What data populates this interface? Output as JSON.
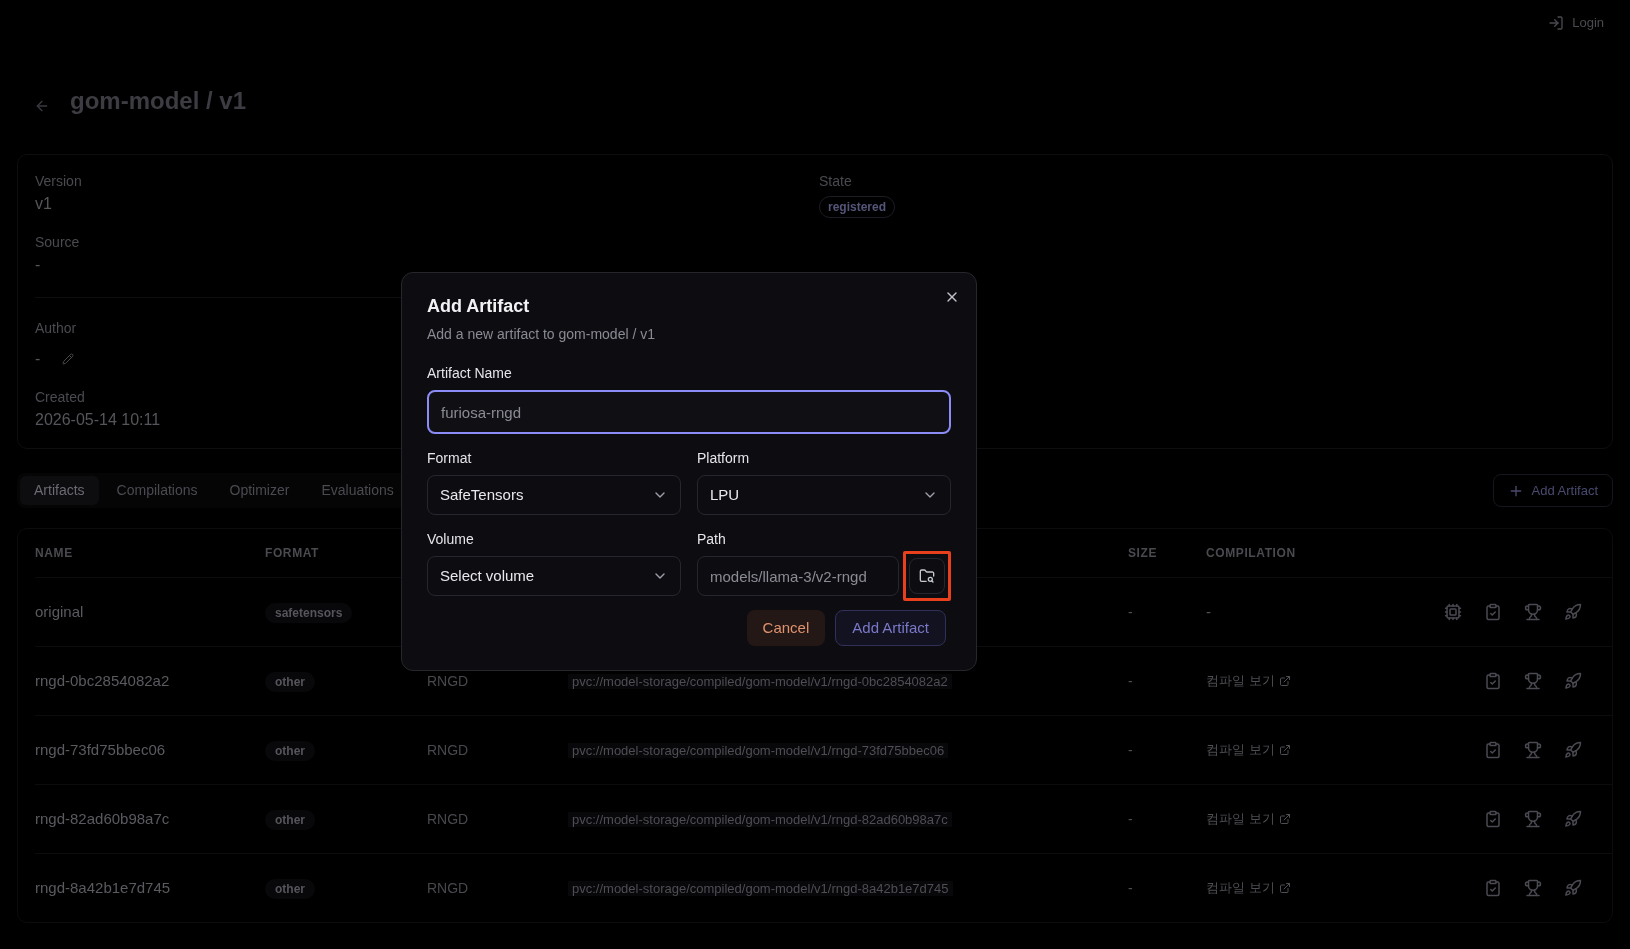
{
  "header": {
    "login": "Login"
  },
  "page_title": "gom-model / v1",
  "details": {
    "left": [
      {
        "label": "Version",
        "value": "v1"
      },
      {
        "label": "Source",
        "value": "-"
      },
      {
        "label": "Author",
        "value": "-",
        "editable": true
      },
      {
        "label": "Created",
        "value": "2026-05-14 10:11"
      }
    ],
    "state": {
      "label": "State",
      "badge": "registered"
    }
  },
  "tabs": [
    {
      "label": "Artifacts",
      "selected": true
    },
    {
      "label": "Compilations",
      "selected": false
    },
    {
      "label": "Optimizer",
      "selected": false
    },
    {
      "label": "Evaluations",
      "selected": false
    }
  ],
  "add_button": "Add Artifact",
  "table": {
    "columns": [
      "NAME",
      "FORMAT",
      null,
      null,
      "SIZE",
      "COMPILATION"
    ],
    "rows": [
      {
        "name": "original",
        "format": "safetensors",
        "size": "-",
        "compilation": {
          "kind": "text",
          "text": "-"
        },
        "kind": "original"
      },
      {
        "name": "rngd-0bc2854082a2",
        "format": "other",
        "platform": "RNGD",
        "path": "pvc://model-storage/compiled/gom-model/v1/rngd-0bc2854082a2",
        "size": "-",
        "compilation": {
          "kind": "link",
          "text": "컴파일 보기"
        },
        "kind": "compiled"
      },
      {
        "name": "rngd-73fd75bbec06",
        "format": "other",
        "platform": "RNGD",
        "path": "pvc://model-storage/compiled/gom-model/v1/rngd-73fd75bbec06",
        "size": "-",
        "compilation": {
          "kind": "link",
          "text": "컴파일 보기"
        },
        "kind": "compiled"
      },
      {
        "name": "rngd-82ad60b98a7c",
        "format": "other",
        "platform": "RNGD",
        "path": "pvc://model-storage/compiled/gom-model/v1/rngd-82ad60b98a7c",
        "size": "-",
        "compilation": {
          "kind": "link",
          "text": "컴파일 보기"
        },
        "kind": "compiled"
      },
      {
        "name": "rngd-8a42b1e7d745",
        "format": "other",
        "platform": "RNGD",
        "path": "pvc://model-storage/compiled/gom-model/v1/rngd-8a42b1e7d745",
        "size": "-",
        "compilation": {
          "kind": "link",
          "text": "컴파일 보기"
        },
        "kind": "compiled"
      }
    ]
  },
  "dialog": {
    "title": "Add Artifact",
    "description": "Add a new artifact to gom-model / v1",
    "fields": [
      {
        "kind": "input",
        "label": "Artifact Name",
        "placeholder": "furiosa-rngd",
        "focused": true
      },
      {
        "kind": "select",
        "label": "Format",
        "value": "SafeTensors"
      },
      {
        "kind": "select",
        "label": "Platform",
        "value": "LPU"
      },
      {
        "kind": "select",
        "label": "Volume",
        "value": "Select volume"
      },
      {
        "kind": "path",
        "label": "Path",
        "placeholder": "models/llama-3/v2-rngd",
        "highlighted": true
      }
    ],
    "buttons": [
      {
        "kind": "cancel",
        "label": "Cancel"
      },
      {
        "kind": "primary",
        "label": "Add Artifact"
      }
    ]
  }
}
